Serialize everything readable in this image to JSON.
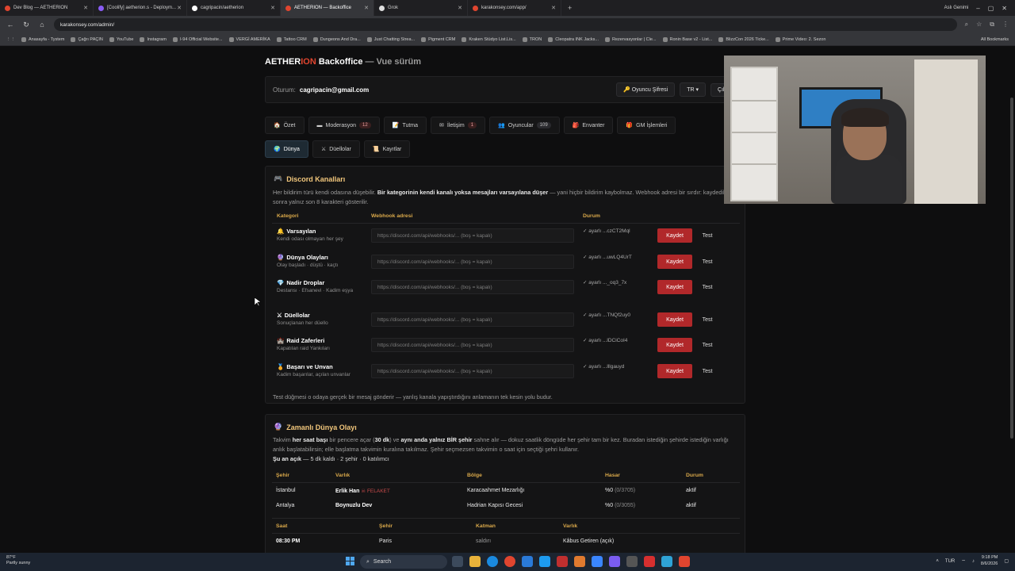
{
  "browser": {
    "tabs": [
      {
        "label": "Dev Blog — AETHERION",
        "color": "#e0452f",
        "active": false
      },
      {
        "label": "[Coolify] aetherion.s - Deploym...",
        "color": "#8a5cf6",
        "active": false
      },
      {
        "label": "cagripacin/aetherion",
        "color": "#ffffff",
        "active": false
      },
      {
        "label": "AETHERION — Backoffice",
        "color": "#e0452f",
        "active": true
      },
      {
        "label": "Grok",
        "color": "#dddddd",
        "active": false
      },
      {
        "label": "karakonsey.com/app/",
        "color": "#e0452f",
        "active": false
      }
    ],
    "profile": "Aslı Genimi",
    "url": "karakonsey.com/admin/",
    "bookmarks": [
      "Anasayfa - Tystem",
      "Çağrı PAÇIN",
      "YouTube",
      "Instagram",
      "I-94 Official Website...",
      "VERGİ AMERİKA",
      "Tattoo CRM",
      "Dungeons And Dra...",
      "Just Chatting Strea...",
      "Pigment CRM",
      "Kraken Stüdyo List.Lis...",
      "TRON",
      "Cleopatra INK Jacks...",
      "Rezervasyonlar | Cle...",
      "Ronin Base v2 - List...",
      "BlizzCon 2026 Ticke...",
      "Prime Video: 2. Sezon"
    ],
    "all_bookmarks": "All Bookmarks"
  },
  "header": {
    "title_a": "AETHER",
    "title_b": "ION",
    "title_c": " Backoffice",
    "title_sub": " — Vue sürüm",
    "session_label": "Oturum:",
    "session_email": "cagripacin@gmail.com",
    "player_password_btn": "Oyuncu Şifresi",
    "lang": "TR",
    "logout": "Çıkış"
  },
  "nav": {
    "tabs_row1": [
      {
        "icon": "🏠",
        "label": "Özet",
        "badge": ""
      },
      {
        "icon": "▬",
        "label": "Moderasyon",
        "badge": "12"
      },
      {
        "icon": "📝",
        "label": "Tutma",
        "badge": ""
      },
      {
        "icon": "✉",
        "label": "İletişim",
        "badge": "1"
      },
      {
        "icon": "👥",
        "label": "Oyuncular",
        "badge": "109"
      },
      {
        "icon": "🎒",
        "label": "Envanter",
        "badge": ""
      },
      {
        "icon": "🎁",
        "label": "GM İşlemleri",
        "badge": ""
      }
    ],
    "tabs_row2": [
      {
        "icon": "🌍",
        "label": "Dünya",
        "active": true
      },
      {
        "icon": "⚔",
        "label": "Düellolar",
        "active": false
      },
      {
        "icon": "📜",
        "label": "Kayıtlar",
        "active": false
      }
    ]
  },
  "discord": {
    "title": "Discord Kanalları",
    "desc_a": "Her bildirim türü kendi odasına düşebilir. ",
    "desc_b": "Bir kategorinin kendi kanalı yoksa mesajları varsayılana düşer",
    "desc_c": " — yani hiçbir bildirim kaybolmaz. Webhook adresi bir sırdır: kaydedildikten sonra yalnız son 8 karakteri gösterilir.",
    "col_category": "Kategori",
    "col_webhook": "Webhook adresi",
    "col_status": "Durum",
    "placeholder": "https://discord.com/api/webhooks/... (boş = kapalı)",
    "save_label": "Kaydet",
    "test_label": "Test",
    "rows": [
      {
        "icon": "🔔",
        "name": "Varsayılan",
        "sub": "Kendi odası olmayan her şey",
        "status": "✓ ayarlı ...czCT2Mql"
      },
      {
        "icon": "🔮",
        "name": "Dünya Olayları",
        "sub": "Olay başladı · düştü · kaçtı",
        "status": "✓ ayarlı ...uwLQ4UrT"
      },
      {
        "icon": "💎",
        "name": "Nadir Droplar",
        "sub": "Destansı · Efsanevi · Kadim eşya",
        "status": "✓ ayarlı ..._oq3_7x"
      },
      {
        "icon": "⚔",
        "name": "Düellolar",
        "sub": "Sonuçlanan her düello",
        "status": "✓ ayarlı ...TNQf2uy0"
      },
      {
        "icon": "🏰",
        "name": "Raid Zaferleri",
        "sub": "Kapatılan raid Yankıları",
        "status": "✓ ayarlı ...lDCiCoI4"
      },
      {
        "icon": "🏅",
        "name": "Başarı ve Unvan",
        "sub": "Kadim başarılar, açılan unvanlar",
        "status": "✓ ayarlı ...lllgauyd"
      }
    ],
    "footnote": "Test düğmesi o odaya gerçek bir mesaj gönderir — yanlış kanala yapıştırdığını anlamanın tek kesin yolu budur."
  },
  "event": {
    "title": "Zamanlı Dünya Olayı",
    "desc_a": "Takvim ",
    "desc_b": "her saat başı",
    "desc_c": " bir pencere açar (",
    "desc_d": "30 dk",
    "desc_e": ") ve ",
    "desc_f": "aynı anda yalnız BİR şehir",
    "desc_g": " sahne alır — dokuz saatlik döngüde her şehir tam bir kez. Buradan istediğin şehirde istediğin varlığı anlık başlatabilirsin; elle başlatma takvimin kuralına takılmaz. Şehir seçmezsen takvimin o saat için seçtiği şehri kullanır.",
    "open_label": "Şu an açık",
    "open_detail": " — 5 dk kaldı · 2 şehir · 0 katılımcı",
    "cols": [
      "Şehir",
      "Varlık",
      "Bölge",
      "Hasar",
      "Durum"
    ],
    "rows": [
      {
        "city": "İstanbul",
        "entity": "Erlik Han",
        "tag": "☠ FELAKET",
        "region": "Karacaahmet Mezarlığı",
        "damage": "%0",
        "damage_detail": " (0/3705)",
        "state": "aktif"
      },
      {
        "city": "Antalya",
        "entity": "Boynuzlu Dev",
        "tag": "",
        "region": "Hadrian Kapısı Gecesi",
        "damage": "%0",
        "damage_detail": " (0/3055)",
        "state": "aktif"
      }
    ],
    "cols2": [
      "Saat",
      "Şehir",
      "Katman",
      "Varlık"
    ],
    "row2": {
      "time": "08:30 PM",
      "city": "Paris",
      "layer": "saldırı",
      "entity": "Kâbus Getiren (açık)"
    }
  },
  "taskbar": {
    "weather_temp": "87°F",
    "weather_desc": "Partly sunny",
    "search": "Search",
    "lang": "TUR",
    "time": "9:18 PM",
    "date": "8/6/2026"
  },
  "colors": {
    "accent_red": "#b1282a",
    "gold": "#d9a84a",
    "brand_ion": "#e0452f"
  }
}
